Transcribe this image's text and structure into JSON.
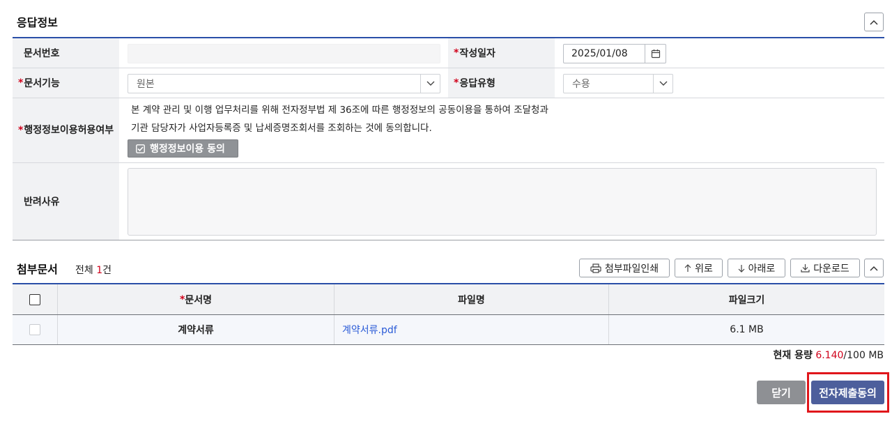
{
  "response_section": {
    "title": "응답정보",
    "fields": {
      "doc_number": {
        "label": "문서번호",
        "value": ""
      },
      "write_date": {
        "required": "*",
        "label": "작성일자",
        "value": "2025/01/08"
      },
      "doc_function": {
        "required": "*",
        "label": "문서기능",
        "value": "원본"
      },
      "response_type": {
        "required": "*",
        "label": "응답유형",
        "value": "수용"
      },
      "admin_info_consent": {
        "required": "*",
        "label": "행정정보이용허용여부",
        "text_line1": "본 계약 관리 및 이행 업무처리를 위해 전자정부법 제 36조에 따른 행정정보의 공동이용을 통하여 조달청과",
        "text_line2": "기관 담당자가 사업자등록증 및 납세증명조회서를 조회하는 것에 동의합니다.",
        "button_label": "행정정보이용 동의"
      },
      "reject_reason": {
        "label": "반려사유",
        "value": ""
      }
    }
  },
  "attachments_section": {
    "title": "첨부문서",
    "total_prefix": "전체",
    "total_count": "1",
    "total_suffix": "건",
    "toolbar": {
      "print": "첨부파일인쇄",
      "up": "위로",
      "down": "아래로",
      "download": "다운로드"
    },
    "columns": {
      "doc_name_required": "*",
      "doc_name": "문서명",
      "file_name": "파일명",
      "file_size": "파일크기"
    },
    "rows": [
      {
        "doc_name": "계약서류",
        "file_name": "계약서류.pdf",
        "file_size": "6.1 MB"
      }
    ],
    "capacity": {
      "label": "현재 용량",
      "current": "6.140",
      "separator": "/",
      "max": "100 MB"
    }
  },
  "footer": {
    "close_label": "닫기",
    "submit_label": "전자제출동의"
  },
  "colors": {
    "accent_blue": "#2a4fa8",
    "required_red": "#d0021b",
    "link_blue": "#2a5bd7",
    "submit_button": "#4d5f9c",
    "highlight_red": "#e0161b"
  }
}
